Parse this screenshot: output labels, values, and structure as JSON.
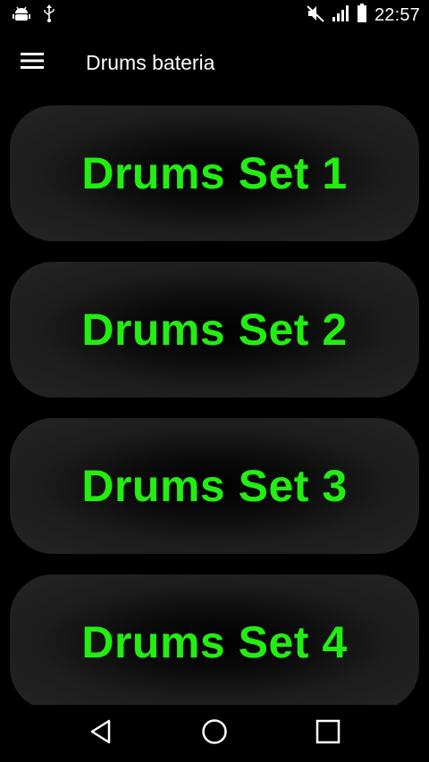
{
  "status_bar": {
    "time": "22:57",
    "icons": [
      "android-debug-icon",
      "usb-icon",
      "mute-icon",
      "signal-icon",
      "battery-icon"
    ]
  },
  "app_bar": {
    "menu_icon": "hamburger-menu-icon",
    "title": "Drums bateria"
  },
  "drum_sets": [
    {
      "label": "Drums Set 1"
    },
    {
      "label": "Drums Set 2"
    },
    {
      "label": "Drums Set 3"
    },
    {
      "label": "Drums Set 4"
    }
  ],
  "nav_bar": {
    "icons": [
      "back-icon",
      "home-icon",
      "recents-icon"
    ]
  },
  "colors": {
    "background": "#000000",
    "label_green": "#22ee11",
    "button_gray": "#242424"
  }
}
